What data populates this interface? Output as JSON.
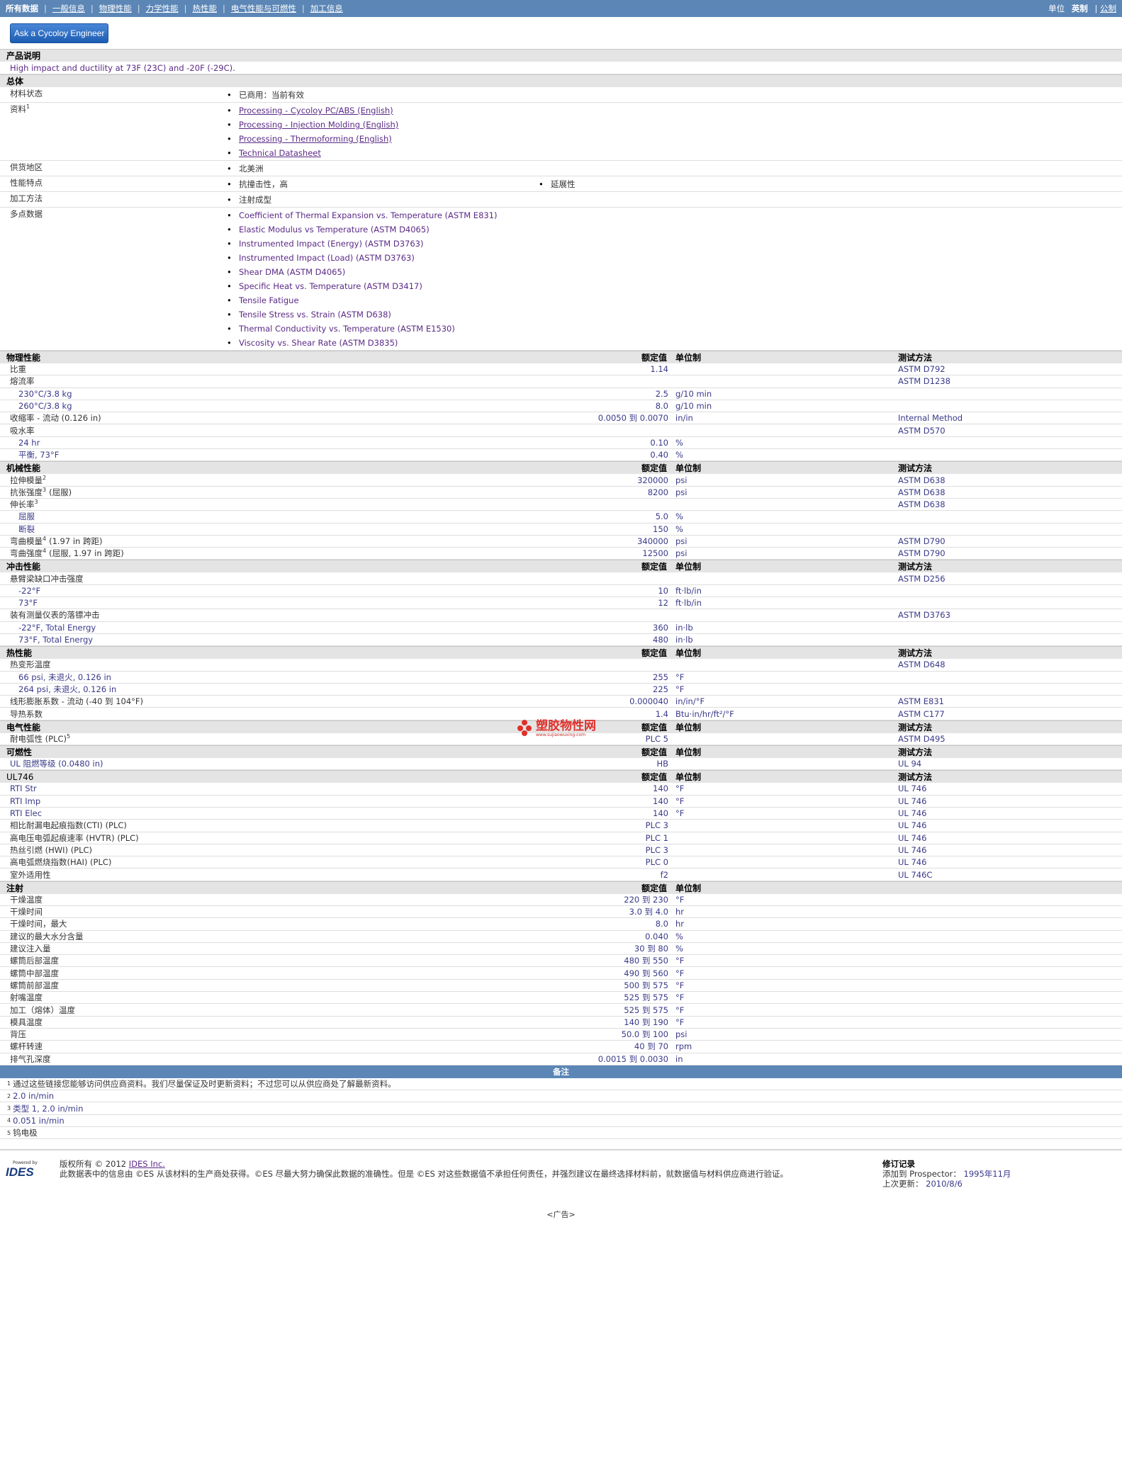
{
  "topnav": {
    "items": [
      "所有数据",
      "一般信息",
      "物理性能",
      "力学性能",
      "热性能",
      "电气性能与可燃性",
      "加工信息"
    ],
    "units_label": "单位",
    "unit_english": "英制",
    "unit_metric": "公制"
  },
  "ask_button": "Ask a Cycoloy Engineer",
  "product": {
    "header": "产品说明",
    "description": "High impact and ductility at 73F (23C) and -20F (-29C)."
  },
  "general": {
    "header": "总体",
    "rows": [
      {
        "label": "材料状态",
        "items": [
          "已商用：当前有效"
        ]
      },
      {
        "label": "资料",
        "sup": "1",
        "links": [
          "Processing - Cycoloy PC/ABS (English)",
          "Processing - Injection Molding (English)",
          "Processing - Thermoforming (English)",
          "Technical Datasheet"
        ]
      },
      {
        "label": "供货地区",
        "items": [
          "北美洲"
        ]
      },
      {
        "label": "性能特点",
        "items": [
          "抗撞击性，高"
        ],
        "items2": [
          "延展性"
        ]
      },
      {
        "label": "加工方法",
        "items": [
          "注射成型"
        ]
      },
      {
        "label": "多点数据",
        "items": [
          "Coefficient of Thermal Expansion vs. Temperature (ASTM E831)",
          "Elastic Modulus vs Temperature (ASTM D4065)",
          "Instrumented Impact (Energy) (ASTM D3763)",
          "Instrumented Impact (Load) (ASTM D3763)",
          "Shear DMA (ASTM D4065)",
          "Specific Heat vs. Temperature (ASTM D3417)",
          "Tensile Fatigue",
          "Tensile Stress vs. Strain (ASTM D638)",
          "Thermal Conductivity vs. Temperature (ASTM E1530)",
          "Viscosity vs. Shear Rate (ASTM D3835)"
        ]
      }
    ]
  },
  "col_labels": {
    "value": "额定值",
    "unit": "单位制",
    "test": "测试方法"
  },
  "sections": [
    {
      "header": "物理性能",
      "rows": [
        {
          "n": "比重",
          "v": "1.14",
          "u": "",
          "t": "ASTM D792"
        },
        {
          "n": "熔流率",
          "v": "",
          "u": "",
          "t": "ASTM D1238"
        },
        {
          "n": "230°C/3.8 kg",
          "sub": true,
          "v": "2.5",
          "u": "g/10 min",
          "t": ""
        },
        {
          "n": "260°C/3.8 kg",
          "sub": true,
          "v": "8.0",
          "u": "g/10 min",
          "t": ""
        },
        {
          "n": "收缩率 - 流动 (0.126 in)",
          "v": "0.0050 到 0.0070",
          "u": "in/in",
          "t": "Internal Method"
        },
        {
          "n": "吸水率",
          "v": "",
          "u": "",
          "t": "ASTM D570"
        },
        {
          "n": "24 hr",
          "sub": true,
          "v": "0.10",
          "u": "%",
          "t": ""
        },
        {
          "n": "平衡, 73°F",
          "sub": true,
          "v": "0.40",
          "u": "%",
          "t": ""
        }
      ]
    },
    {
      "header": "机械性能",
      "rows": [
        {
          "n": "拉伸模量",
          "sup": "2",
          "v": "320000",
          "u": "psi",
          "t": "ASTM D638"
        },
        {
          "n": "抗张强度",
          "sup": "3",
          "suffix": "(屈服)",
          "v": "8200",
          "u": "psi",
          "t": "ASTM D638"
        },
        {
          "n": "伸长率",
          "sup": "3",
          "v": "",
          "u": "",
          "t": "ASTM D638"
        },
        {
          "n": "屈服",
          "sub": true,
          "v": "5.0",
          "u": "%",
          "t": ""
        },
        {
          "n": "断裂",
          "sub": true,
          "v": "150",
          "u": "%",
          "t": ""
        },
        {
          "n": "弯曲模量",
          "sup": "4",
          "suffix": "(1.97 in 跨距)",
          "v": "340000",
          "u": "psi",
          "t": "ASTM D790"
        },
        {
          "n": "弯曲强度",
          "sup": "4",
          "suffix": "(屈服, 1.97 in 跨距)",
          "v": "12500",
          "u": "psi",
          "t": "ASTM D790"
        }
      ]
    },
    {
      "header": "冲击性能",
      "rows": [
        {
          "n": "悬臂梁缺口冲击强度",
          "v": "",
          "u": "",
          "t": "ASTM D256"
        },
        {
          "n": "-22°F",
          "sub": true,
          "v": "10",
          "u": "ft·lb/in",
          "t": ""
        },
        {
          "n": "73°F",
          "sub": true,
          "v": "12",
          "u": "ft·lb/in",
          "t": ""
        },
        {
          "n": "装有测量仪表的落镖冲击",
          "v": "",
          "u": "",
          "t": "ASTM D3763"
        },
        {
          "n": "-22°F, Total Energy",
          "sub": true,
          "v": "360",
          "u": "in·lb",
          "t": ""
        },
        {
          "n": "73°F, Total Energy",
          "sub": true,
          "v": "480",
          "u": "in·lb",
          "t": ""
        }
      ]
    },
    {
      "header": "热性能",
      "rows": [
        {
          "n": "热变形温度",
          "v": "",
          "u": "",
          "t": "ASTM D648"
        },
        {
          "n": "66 psi, 未退火, 0.126 in",
          "sub": true,
          "v": "255",
          "u": "°F",
          "t": ""
        },
        {
          "n": "264 psi, 未退火, 0.126 in",
          "sub": true,
          "v": "225",
          "u": "°F",
          "t": ""
        },
        {
          "n": "线形膨胀系数 - 流动 (-40 到 104°F)",
          "v": "0.000040",
          "u": "in/in/°F",
          "t": "ASTM E831"
        },
        {
          "n": "导热系数",
          "v": "1.4",
          "u": "Btu·in/hr/ft²/°F",
          "t": "ASTM C177"
        }
      ]
    },
    {
      "header": "电气性能",
      "rows": [
        {
          "n": "耐电弧性 (PLC)",
          "sup": "5",
          "v": "PLC 5",
          "u": "",
          "t": "ASTM D495"
        }
      ]
    },
    {
      "header": "可燃性",
      "rows": [
        {
          "n": "UL 阻燃等级 (0.0480 in)",
          "v": "HB",
          "u": "",
          "t": "UL 94"
        }
      ]
    },
    {
      "header": "UL746",
      "rows": [
        {
          "n": "RTI Str",
          "v": "140",
          "u": "°F",
          "t": "UL 746"
        },
        {
          "n": "RTI Imp",
          "v": "140",
          "u": "°F",
          "t": "UL 746"
        },
        {
          "n": "RTI Elec",
          "v": "140",
          "u": "°F",
          "t": "UL 746"
        },
        {
          "n": "相比耐漏电起痕指数(CTI) (PLC)",
          "v": "PLC 3",
          "u": "",
          "t": "UL 746"
        },
        {
          "n": "高电压电弧起痕速率 (HVTR) (PLC)",
          "v": "PLC 1",
          "u": "",
          "t": "UL 746"
        },
        {
          "n": "热丝引燃 (HWI) (PLC)",
          "v": "PLC 3",
          "u": "",
          "t": "UL 746"
        },
        {
          "n": "高电弧燃烧指数(HAI) (PLC)",
          "v": "PLC 0",
          "u": "",
          "t": "UL 746"
        },
        {
          "n": "室外适用性",
          "v": "f2",
          "u": "",
          "t": "UL 746C"
        }
      ]
    },
    {
      "header": "注射",
      "no_test": true,
      "rows": [
        {
          "n": "干燥温度",
          "v": "220 到 230",
          "u": "°F",
          "t": ""
        },
        {
          "n": "干燥时间",
          "v": "3.0 到 4.0",
          "u": "hr",
          "t": ""
        },
        {
          "n": "干燥时间，最大",
          "v": "8.0",
          "u": "hr",
          "t": ""
        },
        {
          "n": "建议的最大水分含量",
          "v": "0.040",
          "u": "%",
          "t": ""
        },
        {
          "n": "建议注入量",
          "v": "30 到 80",
          "u": "%",
          "t": ""
        },
        {
          "n": "螺筒后部温度",
          "v": "480 到 550",
          "u": "°F",
          "t": ""
        },
        {
          "n": "螺筒中部温度",
          "v": "490 到 560",
          "u": "°F",
          "t": ""
        },
        {
          "n": "螺筒前部温度",
          "v": "500 到 575",
          "u": "°F",
          "t": ""
        },
        {
          "n": "射嘴温度",
          "v": "525 到 575",
          "u": "°F",
          "t": ""
        },
        {
          "n": "加工（熔体）温度",
          "v": "525 到 575",
          "u": "°F",
          "t": ""
        },
        {
          "n": "模具温度",
          "v": "140 到 190",
          "u": "°F",
          "t": ""
        },
        {
          "n": "背压",
          "v": "50.0 到 100",
          "u": "psi",
          "t": ""
        },
        {
          "n": "螺杆转速",
          "v": "40 到 70",
          "u": "rpm",
          "t": ""
        },
        {
          "n": "排气孔深度",
          "v": "0.0015 到 0.0030",
          "u": "in",
          "t": ""
        }
      ]
    }
  ],
  "notes": {
    "header": "备注",
    "items": [
      {
        "sup": "1",
        "text": "通过这些链接您能够访问供应商资料。我们尽量保证及时更新资料；不过您可以从供应商处了解最新资料。"
      },
      {
        "sup": "2",
        "text": "2.0 in/min"
      },
      {
        "sup": "3",
        "text": "类型 1, 2.0 in/min"
      },
      {
        "sup": "4",
        "text": "0.051 in/min"
      },
      {
        "sup": "5",
        "text": "钨电极"
      }
    ]
  },
  "footer": {
    "logo_powered": "Powered by",
    "logo_name": "IDES",
    "copyright": "版权所有 © 2012",
    "company_link": "IDES Inc.",
    "disclaimer": "此数据表中的信息由 ©ES 从该材料的生产商处获得。©ES 尽最大努力确保此数据的准确性。但是 ©ES 对这些数据值不承担任何责任，并强烈建议在最终选择材料前，就数据值与材料供应商进行验证。",
    "revision_title": "修订记录",
    "added_label": "添加到 Prospector：",
    "added_value": "1995年11月",
    "updated_label": "上次更新：",
    "updated_value": "2010/8/6",
    "ad": "<广告>"
  },
  "watermark": {
    "title": "塑胶物性网",
    "url": "www.sujiaowuxing.com"
  }
}
